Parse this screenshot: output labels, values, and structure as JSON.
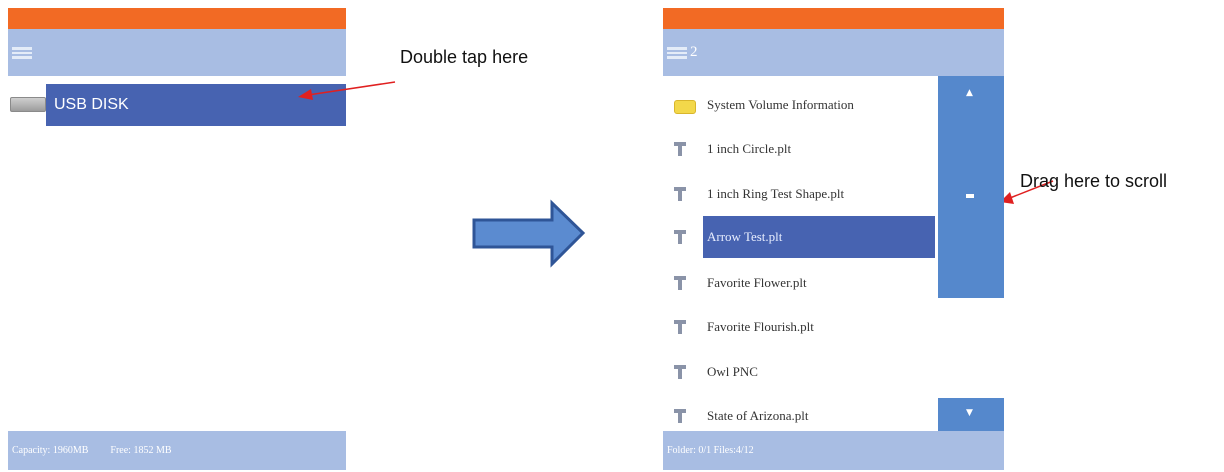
{
  "left_screen": {
    "title": "",
    "drive_label": "USB DISK",
    "status_capacity": "Capacity: 1960MB",
    "status_free": "Free: 1852 MB"
  },
  "right_screen": {
    "title": "2",
    "files": [
      {
        "name": "System Volume Information",
        "type": "folder",
        "selected": false
      },
      {
        "name": "1 inch Circle.plt",
        "type": "file",
        "selected": false
      },
      {
        "name": "1 inch Ring Test Shape.plt",
        "type": "file",
        "selected": false
      },
      {
        "name": "Arrow Test.plt",
        "type": "file",
        "selected": true
      },
      {
        "name": "Favorite Flower.plt",
        "type": "file",
        "selected": false
      },
      {
        "name": "Favorite Flourish.plt",
        "type": "file",
        "selected": false
      },
      {
        "name": "Owl PNC",
        "type": "file",
        "selected": false
      },
      {
        "name": "State of Arizona.plt",
        "type": "file",
        "selected": false
      }
    ],
    "status": "Folder: 0/1 Files:4/12",
    "scroll_up_icon": "▲",
    "scroll_down_icon": "▼"
  },
  "annotations": {
    "double_tap": "Double tap here",
    "drag_scroll": "Drag here to scroll"
  },
  "colors": {
    "top_bar": "#f26a24",
    "title_bar": "#a8bde3",
    "selection": "#4763b1",
    "scroll_thumb": "#5588cc",
    "arrow": "#e02020",
    "transition_arrow": "#5b8bd0"
  },
  "icons": {
    "menu": "menu-icon",
    "drive": "usb-drive-icon",
    "folder": "folder-icon",
    "file": "file-icon",
    "transition": "right-arrow-icon"
  }
}
